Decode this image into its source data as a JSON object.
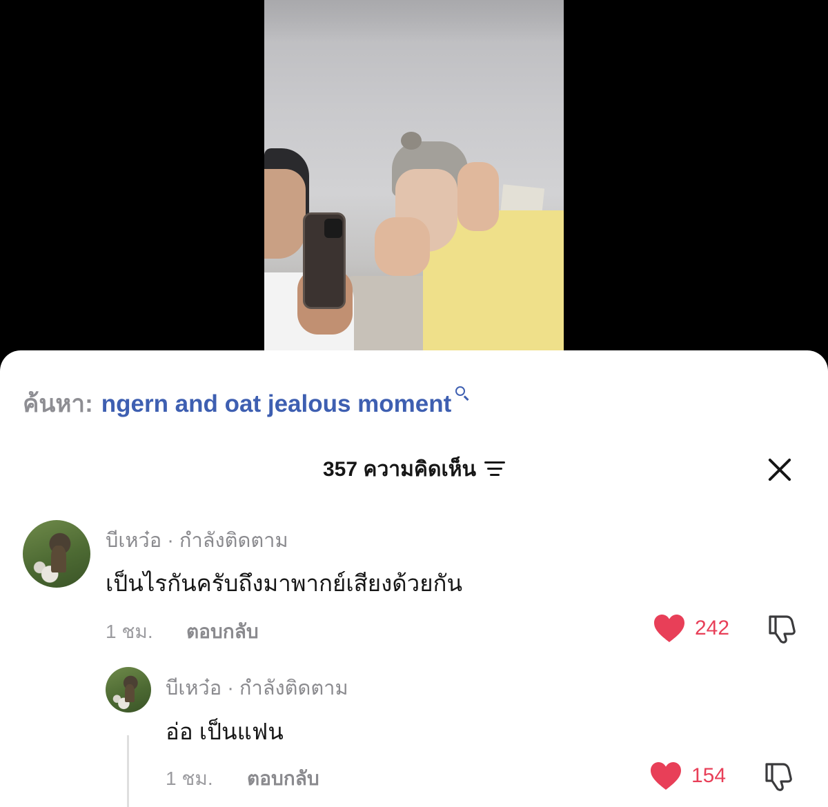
{
  "search": {
    "prefix": "ค้นหา:",
    "query": "ngern and oat jealous moment"
  },
  "comments_header": {
    "count_label": "357 ความคิดเห็น"
  },
  "comments": [
    {
      "username": "บีเหว๋อ",
      "status": " · กำลังติดตาม",
      "text": "เป็นไรกันครับถึงมาพากย์เสียงด้วยกัน",
      "time": "1 ชม.",
      "reply_label": "ตอบกลับ",
      "likes": "242",
      "replies": [
        {
          "username": "บีเหว๋อ",
          "status": " · กำลังติดตาม",
          "text": "อ่อ เป็นแฟน",
          "time": "1 ชม.",
          "reply_label": "ตอบกลับ",
          "likes": "154"
        }
      ]
    }
  ],
  "colors": {
    "accent_link": "#3e5fb1",
    "like_red": "#e83f58",
    "muted_text": "#8a8a8e"
  },
  "icons": [
    "search-icon",
    "sort-icon",
    "close-icon",
    "heart-icon",
    "dislike-icon"
  ]
}
